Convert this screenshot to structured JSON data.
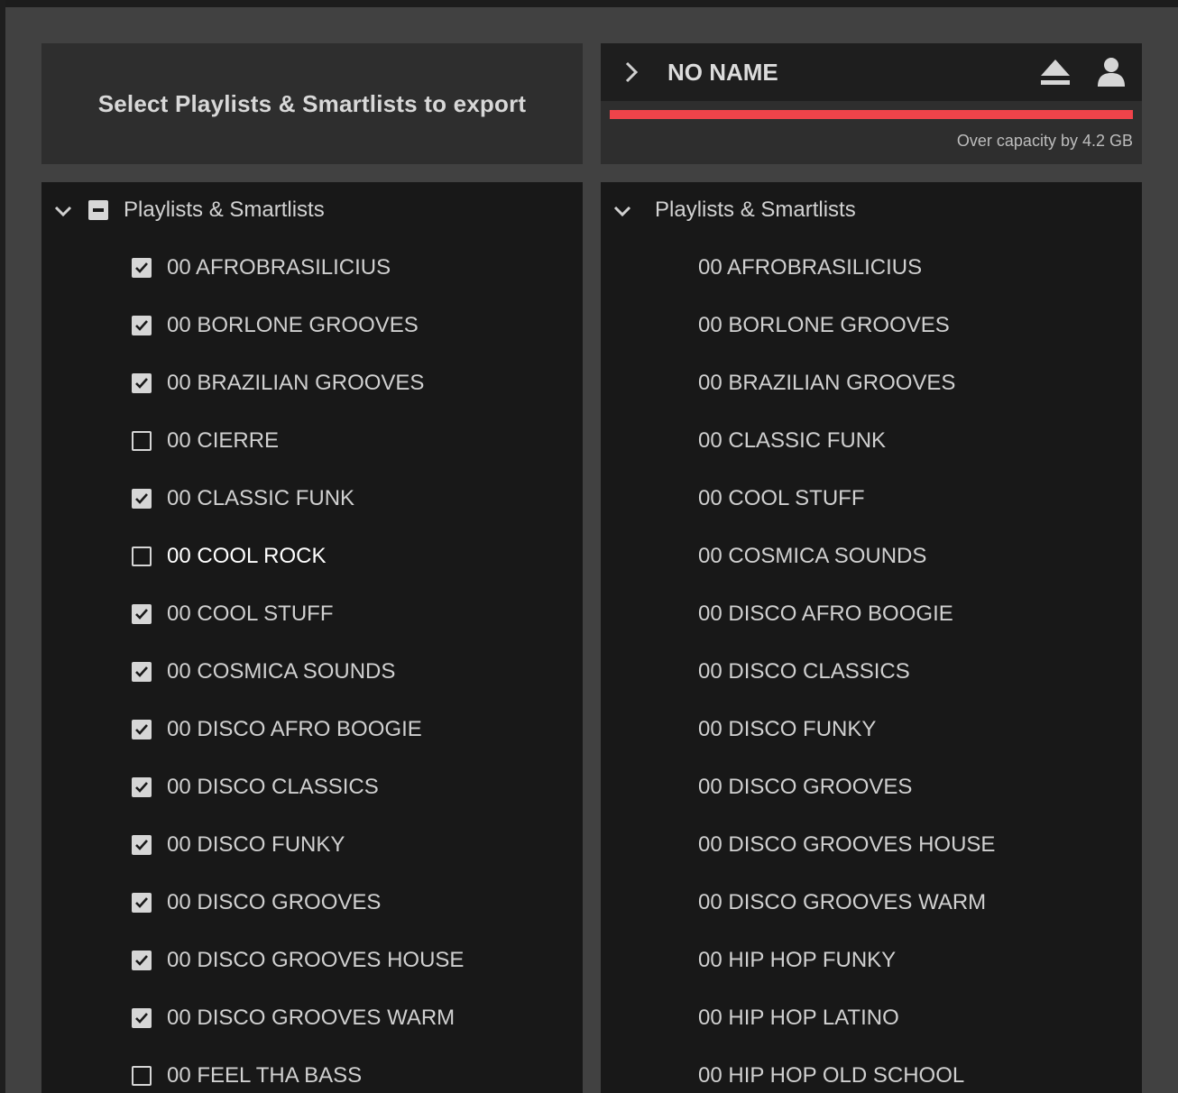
{
  "dialog": {
    "title": "Select Playlists & Smartlists to export"
  },
  "device": {
    "name": "NO NAME",
    "capacity_text": "Over capacity by 4.2 GB",
    "capacity_fraction": 1.0,
    "capacity_color": "#f0434a",
    "icons": {
      "expand": "chevron-right-icon",
      "eject": "eject-icon",
      "user": "user-icon"
    }
  },
  "source_tree": {
    "root_label": "Playlists & Smartlists",
    "root_state": "indeterminate",
    "items": [
      {
        "label": "00 AFROBRASILICIUS",
        "checked": true
      },
      {
        "label": "00 BORLONE GROOVES",
        "checked": true
      },
      {
        "label": "00 BRAZILIAN GROOVES",
        "checked": true
      },
      {
        "label": "00 CIERRE",
        "checked": false
      },
      {
        "label": "00 CLASSIC FUNK",
        "checked": true
      },
      {
        "label": "00 COOL ROCK",
        "checked": false,
        "highlight": true
      },
      {
        "label": "00 COOL STUFF",
        "checked": true
      },
      {
        "label": "00 COSMICA SOUNDS",
        "checked": true
      },
      {
        "label": "00 DISCO AFRO BOOGIE",
        "checked": true
      },
      {
        "label": "00 DISCO CLASSICS",
        "checked": true
      },
      {
        "label": "00 DISCO FUNKY",
        "checked": true
      },
      {
        "label": "00 DISCO GROOVES",
        "checked": true
      },
      {
        "label": "00 DISCO GROOVES HOUSE",
        "checked": true
      },
      {
        "label": "00 DISCO GROOVES WARM",
        "checked": true
      },
      {
        "label": "00 FEEL THA BASS",
        "checked": false
      }
    ]
  },
  "device_tree": {
    "root_label": "Playlists & Smartlists",
    "items": [
      "00 AFROBRASILICIUS",
      "00 BORLONE GROOVES",
      "00 BRAZILIAN GROOVES",
      "00 CLASSIC FUNK",
      "00 COOL STUFF",
      "00 COSMICA SOUNDS",
      "00 DISCO AFRO BOOGIE",
      "00 DISCO CLASSICS",
      "00 DISCO FUNKY",
      "00 DISCO GROOVES",
      "00 DISCO GROOVES HOUSE",
      "00 DISCO GROOVES WARM",
      "00 HIP HOP FUNKY",
      "00 HIP HOP LATINO",
      "00 HIP HOP OLD SCHOOL"
    ]
  }
}
